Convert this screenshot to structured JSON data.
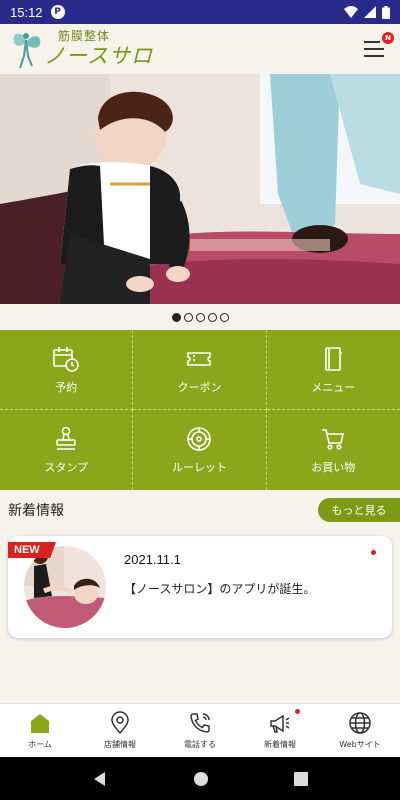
{
  "status_bar": {
    "time": "15:12",
    "notification_letter": "P"
  },
  "header": {
    "logo_sub": "筋膜整体",
    "logo_main": "ノースサロン",
    "menu_badge": "N"
  },
  "carousel": {
    "pages": 5,
    "active": 0
  },
  "grid": [
    {
      "label": "予約",
      "icon": "calendar-clock-icon"
    },
    {
      "label": "クーポン",
      "icon": "ticket-icon"
    },
    {
      "label": "メニュー",
      "icon": "book-icon"
    },
    {
      "label": "スタンプ",
      "icon": "stamp-icon"
    },
    {
      "label": "ルーレット",
      "icon": "roulette-icon"
    },
    {
      "label": "お買い物",
      "icon": "cart-icon"
    }
  ],
  "news": {
    "title": "新着情報",
    "more_label": "もっと見る",
    "items": [
      {
        "badge": "NEW",
        "date": "2021.11.1",
        "text": "【ノースサロン】のアプリが誕生。"
      }
    ]
  },
  "tabs": [
    {
      "label": "ホーム",
      "icon": "home-icon"
    },
    {
      "label": "店舗情報",
      "icon": "map-pin-icon"
    },
    {
      "label": "電話する",
      "icon": "phone-icon"
    },
    {
      "label": "新着情報",
      "icon": "megaphone-icon"
    },
    {
      "label": "Webサイト",
      "icon": "globe-icon"
    }
  ],
  "colors": {
    "accent": "#8ca51a",
    "status_bar": "#2a2a8a",
    "badge_red": "#d8201e",
    "background": "#f6f2ec"
  }
}
